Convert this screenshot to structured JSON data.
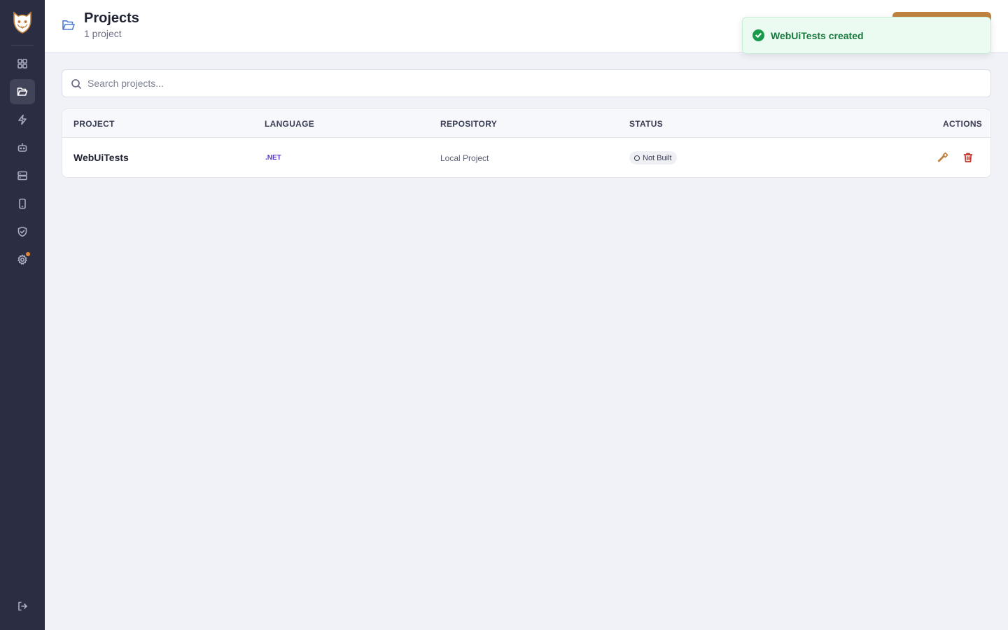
{
  "header": {
    "title": "Projects",
    "subtitle": "1 project"
  },
  "toast": {
    "message": "WebUiTests created"
  },
  "search": {
    "placeholder": "Search projects..."
  },
  "table": {
    "columns": [
      "PROJECT",
      "LANGUAGE",
      "REPOSITORY",
      "STATUS",
      "ACTIONS"
    ],
    "rows": [
      {
        "name": "WebUiTests",
        "language": ".NET",
        "repository": "Local Project",
        "status": "Not Built"
      }
    ]
  },
  "colors": {
    "sidebar": "#2b2d42",
    "accent": "#c1823f",
    "success": "#1a9a4b",
    "danger": "#c0392b",
    "language": "#5a36c4"
  },
  "icons": {
    "sidebar": [
      "logo-icon",
      "dashboard-icon",
      "folder-icon",
      "lightning-icon",
      "robot-icon",
      "server-icon",
      "mobile-icon",
      "shield-icon",
      "gear-icon",
      "logout-icon"
    ],
    "actions": [
      "hammer-icon",
      "trash-icon"
    ]
  }
}
